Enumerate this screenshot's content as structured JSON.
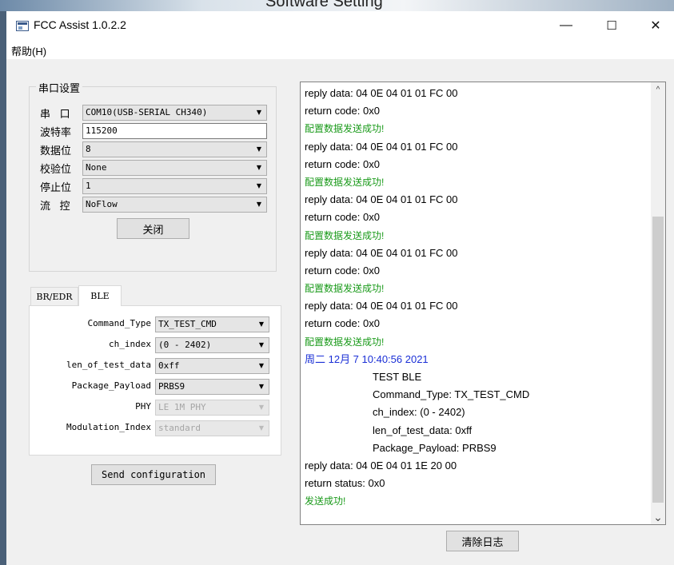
{
  "behind_title": "Software Setting",
  "window": {
    "title": "FCC Assist 1.0.2.2",
    "controls": {
      "minimize": "—",
      "maximize": "☐",
      "close": "✕"
    }
  },
  "menu": {
    "help": "帮助(H)"
  },
  "serial": {
    "group_title": "串口设置",
    "port_label": "串 口",
    "port_value": "COM10(USB-SERIAL CH340)",
    "baud_label": "波特率",
    "baud_value": "115200",
    "databits_label": "数据位",
    "databits_value": "8",
    "parity_label": "校验位",
    "parity_value": "None",
    "stopbits_label": "停止位",
    "stopbits_value": "1",
    "flow_label": "流 控",
    "flow_value": "NoFlow",
    "close_button": "关闭"
  },
  "tabs": {
    "br_edr": "BR/EDR",
    "ble": "BLE"
  },
  "ble": {
    "command_type_label": "Command_Type",
    "command_type_value": "TX_TEST_CMD",
    "ch_index_label": "ch_index",
    "ch_index_value": "(0 - 2402)",
    "len_label": "len_of_test_data",
    "len_value": "0xff",
    "payload_label": "Package_Payload",
    "payload_value": "PRBS9",
    "phy_label": "PHY",
    "phy_value": "LE 1M PHY",
    "mod_label": "Modulation_Index",
    "mod_value": "standard",
    "send_button": "Send configuration"
  },
  "log": {
    "lines": [
      {
        "text": "reply data: 04 0E 04 01 01 FC 00",
        "style": "normal"
      },
      {
        "text": "return code: 0x0",
        "style": "normal"
      },
      {
        "text": "配置数据发送成功!",
        "style": "green"
      },
      {
        "text": "reply data: 04 0E 04 01 01 FC 00",
        "style": "normal"
      },
      {
        "text": "return code: 0x0",
        "style": "normal"
      },
      {
        "text": "配置数据发送成功!",
        "style": "green"
      },
      {
        "text": "reply data: 04 0E 04 01 01 FC 00",
        "style": "normal"
      },
      {
        "text": "return code: 0x0",
        "style": "normal"
      },
      {
        "text": "配置数据发送成功!",
        "style": "green"
      },
      {
        "text": "reply data: 04 0E 04 01 01 FC 00",
        "style": "normal"
      },
      {
        "text": "return code: 0x0",
        "style": "normal"
      },
      {
        "text": "配置数据发送成功!",
        "style": "green"
      },
      {
        "text": "reply data: 04 0E 04 01 01 FC 00",
        "style": "normal"
      },
      {
        "text": "return code: 0x0",
        "style": "normal"
      },
      {
        "text": "配置数据发送成功!",
        "style": "green"
      },
      {
        "text": "周二 12月 7 10:40:56 2021",
        "style": "blue"
      },
      {
        "text": "TEST BLE",
        "style": "indent"
      },
      {
        "text": "Command_Type: TX_TEST_CMD",
        "style": "indent"
      },
      {
        "text": "ch_index: (0 - 2402)",
        "style": "indent"
      },
      {
        "text": "len_of_test_data: 0xff",
        "style": "indent"
      },
      {
        "text": "Package_Payload: PRBS9",
        "style": "indent"
      },
      {
        "text": "reply data: 04 0E 04 01 1E 20 00",
        "style": "normal"
      },
      {
        "text": "return status: 0x0",
        "style": "normal"
      },
      {
        "text": "发送成功!",
        "style": "green"
      }
    ],
    "clear_button": "清除日志"
  },
  "icons": {
    "combo_arrow": "▼",
    "scroll_up": "^",
    "scroll_down": "⌄"
  }
}
